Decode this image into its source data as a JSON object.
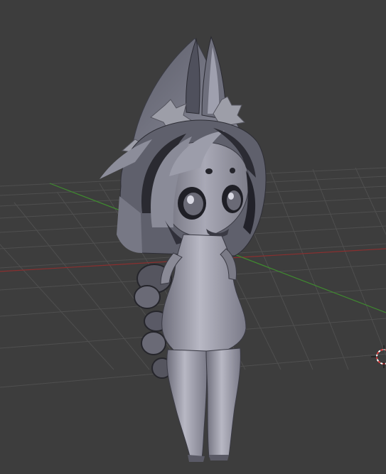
{
  "viewport": {
    "background_color": "#3d3d3d",
    "grid_color": "#4f4f4f",
    "x_axis_color": "#8a2f2f",
    "y_axis_color": "#3f8a2f"
  },
  "model": {
    "type": "chibi character mesh",
    "shading": "solid grey",
    "base_color": "#9a9aa6",
    "shadow_color": "#2c2c34",
    "highlight_color": "#d4d4de"
  },
  "cursor": {
    "icon": "3d-cursor-icon",
    "color_a": "#e04040",
    "color_b": "#ffffff"
  }
}
